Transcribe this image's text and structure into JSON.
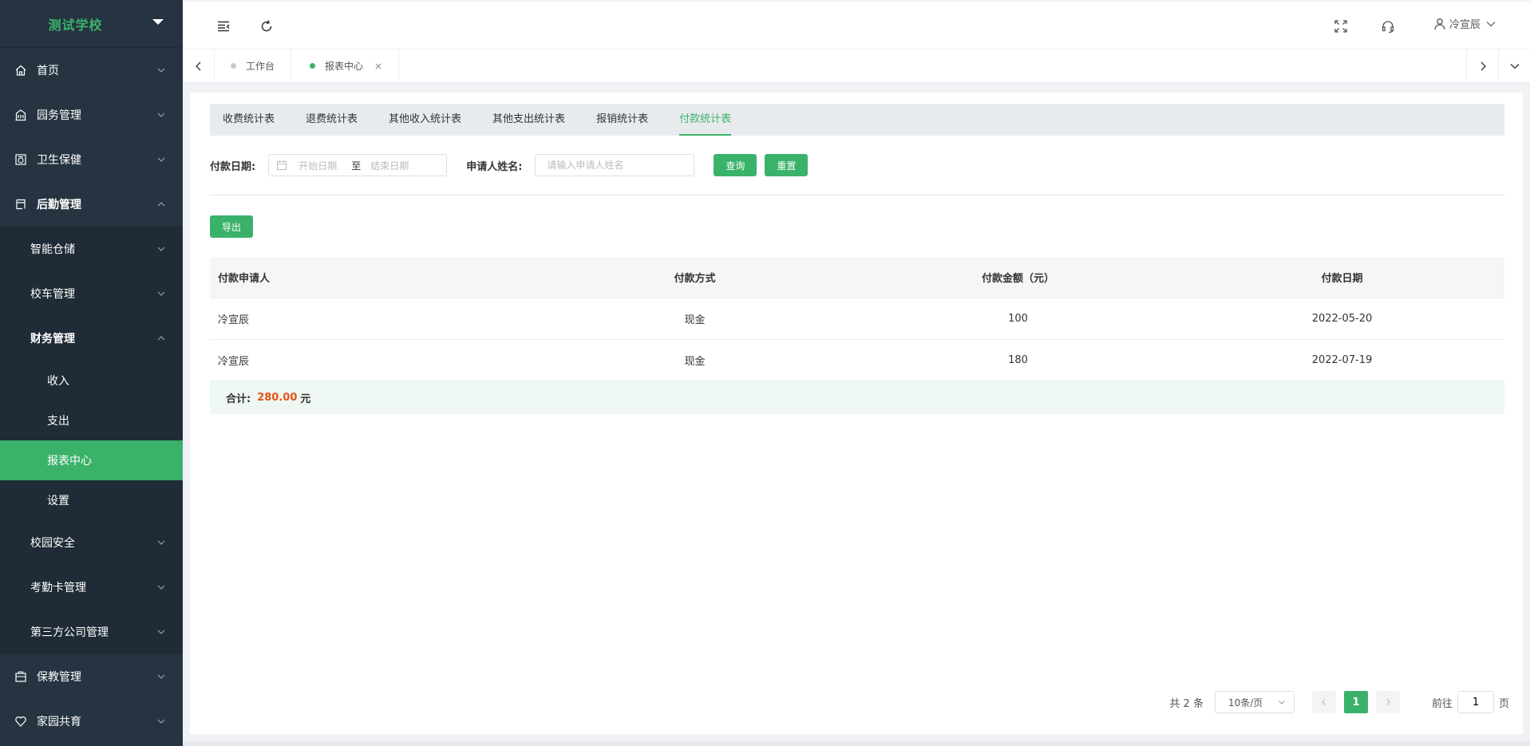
{
  "sidebar": {
    "brand": "测试学校",
    "items": [
      {
        "label": "首页"
      },
      {
        "label": "园务管理"
      },
      {
        "label": "卫生保健"
      },
      {
        "label": "后勤管理"
      },
      {
        "label": "保教管理"
      },
      {
        "label": "家园共育"
      }
    ],
    "logistics_sub": [
      {
        "label": "智能仓储"
      },
      {
        "label": "校车管理"
      },
      {
        "label": "财务管理"
      },
      {
        "label": "校园安全"
      },
      {
        "label": "考勤卡管理"
      },
      {
        "label": "第三方公司管理"
      }
    ],
    "finance_sub": [
      {
        "label": "收入"
      },
      {
        "label": "支出"
      },
      {
        "label": "报表中心"
      },
      {
        "label": "设置"
      }
    ]
  },
  "header": {
    "user_name": "冷宣辰"
  },
  "tabs": [
    {
      "label": "工作台"
    },
    {
      "label": "报表中心",
      "close": "×"
    }
  ],
  "subtabs": [
    {
      "label": "收费统计表"
    },
    {
      "label": "退费统计表"
    },
    {
      "label": "其他收入统计表"
    },
    {
      "label": "其他支出统计表"
    },
    {
      "label": "报销统计表"
    },
    {
      "label": "付款统计表"
    }
  ],
  "filter": {
    "date_label": "付款日期:",
    "start_placeholder": "开始日期",
    "separator": "至",
    "end_placeholder": "结束日期",
    "name_label": "申请人姓名:",
    "name_placeholder": "请输入申请人姓名",
    "query": "查询",
    "reset": "重置"
  },
  "export_label": "导出",
  "table": {
    "columns": [
      "付款申请人",
      "付款方式",
      "付款金额（元）",
      "付款日期"
    ],
    "rows": [
      [
        "冷宣辰",
        "现金",
        "100",
        "2022-05-20"
      ],
      [
        "冷宣辰",
        "现金",
        "180",
        "2022-07-19"
      ]
    ],
    "total_label": "合计:",
    "total_amount": "280.00",
    "total_unit": "元"
  },
  "pager": {
    "total": "共 2 条",
    "page_size": "10条/页",
    "current": "1",
    "goto_prefix": "前往",
    "goto_value": "1",
    "goto_suffix": "页"
  },
  "colors": {
    "accent": "#3bb26a",
    "sidebar": "#263441",
    "submenu": "#1f2b36",
    "amount": "#e3541c"
  }
}
